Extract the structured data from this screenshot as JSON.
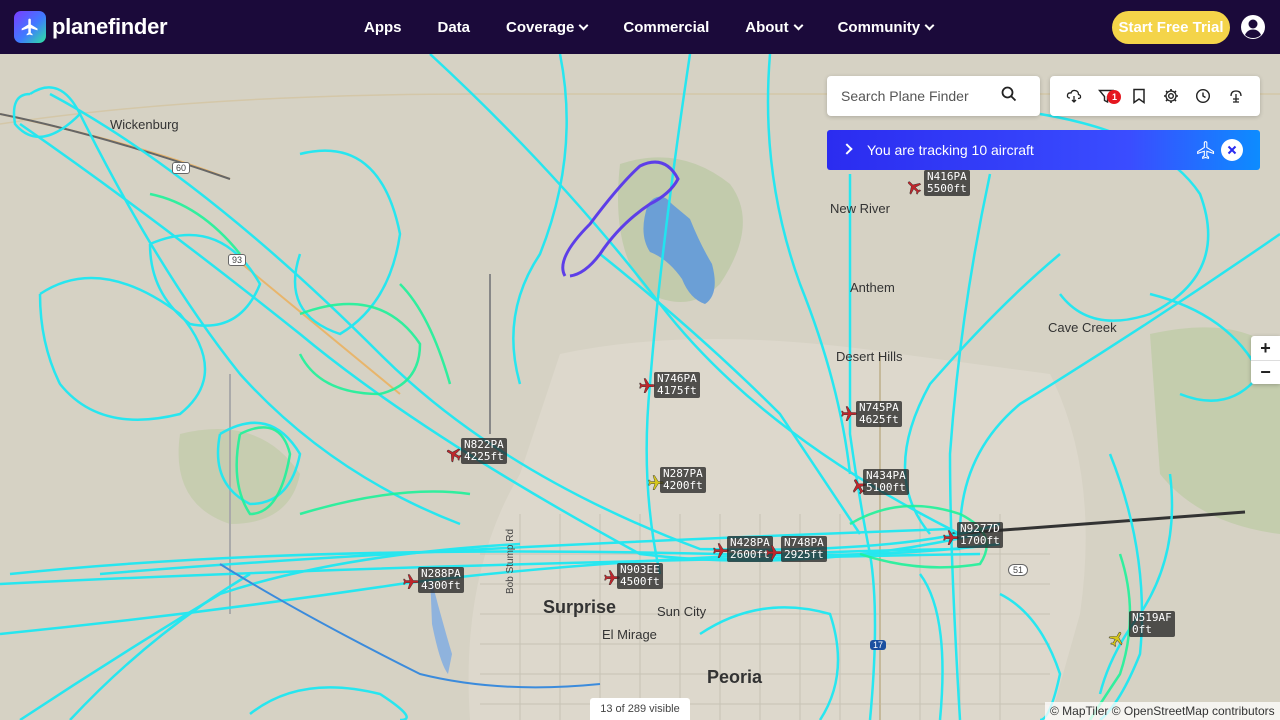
{
  "header": {
    "brand": "planefinder",
    "nav": [
      {
        "label": "Apps",
        "dropdown": false
      },
      {
        "label": "Data",
        "dropdown": false
      },
      {
        "label": "Coverage",
        "dropdown": true
      },
      {
        "label": "Commercial",
        "dropdown": false
      },
      {
        "label": "About",
        "dropdown": true
      },
      {
        "label": "Community",
        "dropdown": true
      }
    ],
    "cta_label": "Start Free Trial",
    "colors": {
      "bar": "#1b0a3a",
      "cta": "#f4d449"
    }
  },
  "search": {
    "placeholder": "Search Plane Finder"
  },
  "toolbar": {
    "icons": [
      "weather-icon",
      "filter-icon",
      "bookmark-icon",
      "settings-icon",
      "history-icon",
      "3d-icon"
    ],
    "filter_badge": "1"
  },
  "tracking": {
    "message": "You are tracking 10 aircraft"
  },
  "zoom": {
    "in": "+",
    "out": "−"
  },
  "places": [
    {
      "name": "Wickenburg",
      "size": "mid"
    },
    {
      "name": "New River",
      "size": "mid"
    },
    {
      "name": "Anthem",
      "size": "mid"
    },
    {
      "name": "Desert Hills",
      "size": "mid"
    },
    {
      "name": "Cave Creek",
      "size": "mid"
    },
    {
      "name": "Surprise",
      "size": "big"
    },
    {
      "name": "Sun City",
      "size": "mid"
    },
    {
      "name": "El Mirage",
      "size": "mid"
    },
    {
      "name": "Peoria",
      "size": "big"
    },
    {
      "name": "Bob Stump Rd",
      "size": "small"
    }
  ],
  "road_shields": [
    "60",
    "93",
    "51",
    "17"
  ],
  "aircraft": [
    {
      "callsign": "N416PA",
      "altitude": "5500ft",
      "color": "#c0262c"
    },
    {
      "callsign": "N746PA",
      "altitude": "4175ft",
      "color": "#c0262c"
    },
    {
      "callsign": "N745PA",
      "altitude": "4625ft",
      "color": "#c0262c"
    },
    {
      "callsign": "N822PA",
      "altitude": "4225ft",
      "color": "#c0262c"
    },
    {
      "callsign": "N287PA",
      "altitude": "4200ft",
      "color": "#d6c61a"
    },
    {
      "callsign": "N434PA",
      "altitude": "5100ft",
      "color": "#c0262c"
    },
    {
      "callsign": "N9277D",
      "altitude": "1700ft",
      "color": "#c0262c"
    },
    {
      "callsign": "N428PA",
      "altitude": "2600ft",
      "color": "#c0262c"
    },
    {
      "callsign": "N748PA",
      "altitude": "2925ft",
      "color": "#c0262c"
    },
    {
      "callsign": "N288PA",
      "altitude": "4300ft",
      "color": "#c0262c"
    },
    {
      "callsign": "N903EE",
      "altitude": "4500ft",
      "color": "#c0262c"
    },
    {
      "callsign": "N519AF",
      "altitude": "0ft",
      "color": "#d6c61a"
    }
  ],
  "status": {
    "visible": "13 of 289 visible"
  },
  "attribution": "© MapTiler © OpenStreetMap contributors",
  "track_colors": {
    "primary": "#1ee8f2",
    "low": "#1ff29a",
    "high": "#5d3ee8",
    "dark": "#333333"
  }
}
